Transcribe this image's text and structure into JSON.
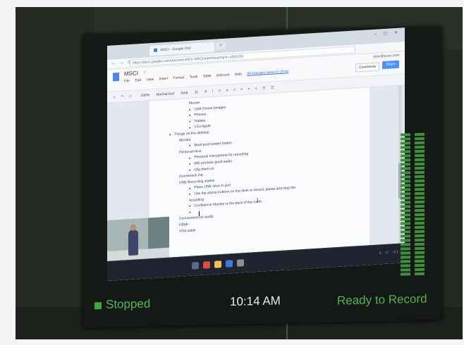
{
  "browser": {
    "tab_title": "MSCI - Google Doc",
    "url": "https://docs.google.com/document/d/1r-MSCI/edit#heading=h.a7b2c3d",
    "nav_glyphs": "← → ⟳",
    "window_controls": "– ▢ ✕"
  },
  "docs": {
    "title": "MSCI",
    "menu": [
      "File",
      "Edit",
      "View",
      "Insert",
      "Format",
      "Tools",
      "Table",
      "Add-ons",
      "Help"
    ],
    "edit_status": "All changes saved in Drive",
    "account": "msci@evvo.com",
    "comments_label": "Comments",
    "share_label": "Share",
    "toolbar": {
      "zoom": "100%",
      "style": "Normal text",
      "font": "Arial",
      "size": "11"
    }
  },
  "document_lines": [
    {
      "level": 3,
      "bullet": false,
      "text": "Mouse"
    },
    {
      "level": 3,
      "bullet": true,
      "text": "USB Drives (images"
    },
    {
      "level": 3,
      "bullet": true,
      "text": "Phones"
    },
    {
      "level": 3,
      "bullet": true,
      "text": "Tablets"
    },
    {
      "level": 3,
      "bullet": true,
      "text": "VCs Apple"
    },
    {
      "level": 1,
      "bullet": true,
      "text": "Things on the desktop"
    },
    {
      "level": 2,
      "bullet": false,
      "text": "Monitor"
    },
    {
      "level": 3,
      "bullet": true,
      "text": "Must push power button"
    },
    {
      "level": 2,
      "bullet": false,
      "text": "Personal mics"
    },
    {
      "level": 3,
      "bullet": true,
      "text": "Personal microphone for recording"
    },
    {
      "level": 3,
      "bullet": true,
      "text": "Will produce good audio"
    },
    {
      "level": 3,
      "bullet": true,
      "text": "Clip them on"
    },
    {
      "level": 2,
      "bullet": false,
      "text": "Gooseneck mic"
    },
    {
      "level": 2,
      "bullet": false,
      "text": "USB Recording station"
    },
    {
      "level": 3,
      "bullet": true,
      "text": "Place USB drive in port"
    },
    {
      "level": 3,
      "bullet": true,
      "text": "Use the above buttons on the desk to record, pause and stop the"
    },
    {
      "level": 3,
      "bullet": false,
      "text": "recording"
    },
    {
      "level": 3,
      "bullet": true,
      "text": "Confidence Monitor is the back of the room"
    },
    {
      "level": 3,
      "bullet": true,
      "text": ""
    },
    {
      "level": 2,
      "bullet": false,
      "text": "Connections for audio"
    },
    {
      "level": 2,
      "bullet": false,
      "text": "HDMI"
    },
    {
      "level": 2,
      "bullet": false,
      "text": "VGA cable"
    }
  ],
  "taskbar_apps": [
    {
      "name": "windows-start",
      "color": "#5c6b8a"
    },
    {
      "name": "chrome",
      "color": "#d94f3d"
    },
    {
      "name": "file-explorer",
      "color": "#e8c35a"
    },
    {
      "name": "store",
      "color": "#3e7bd6"
    },
    {
      "name": "media-player",
      "color": "#8a8f98"
    }
  ],
  "tray_text": "∧ ▭ ◁)",
  "status_bar": {
    "recording_state": "Stopped",
    "time": "10:14 AM",
    "ready_text": "Ready to Record"
  },
  "colors": {
    "status_green": "#53b556",
    "meter_green": "#3f8f3f",
    "docs_blue": "#4d90fe"
  },
  "audio_meter": {
    "channels": 2,
    "level": 0.0
  }
}
